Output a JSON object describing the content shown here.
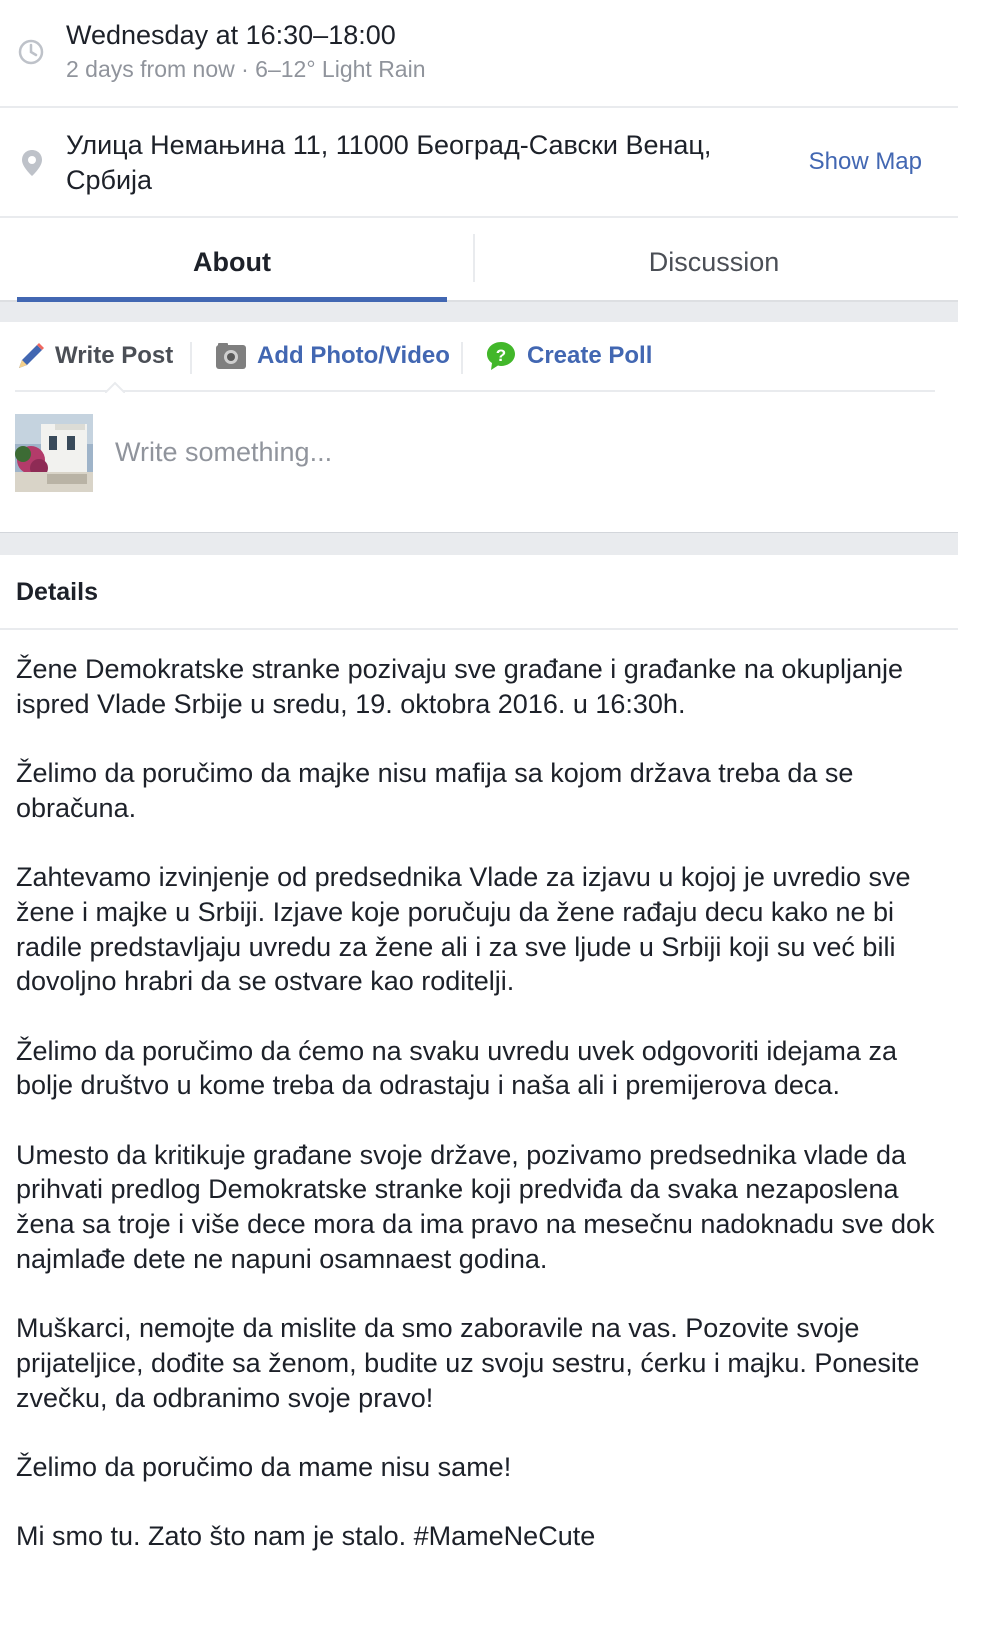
{
  "event": {
    "time_main": "Wednesday at 16:30–18:00",
    "time_sub": "2 days from now · 6–12° Light Rain",
    "location": "Улица Немањина 11, 11000 Београд-Савски Венац, Србија",
    "show_map_label": "Show Map"
  },
  "tabs": [
    {
      "label": "About",
      "active": true
    },
    {
      "label": "Discussion",
      "active": false
    }
  ],
  "composer": {
    "write_post_label": "Write Post",
    "add_photo_label": "Add Photo/Video",
    "create_poll_label": "Create Poll",
    "input_placeholder": "Write something..."
  },
  "details": {
    "title": "Details",
    "paragraphs": [
      "Žene Demokratske stranke pozivaju sve građane i građanke na okupljanje ispred Vlade Srbije u sredu, 19. oktobra 2016. u 16:30h.",
      "Želimo da poručimo da majke nisu mafija sa kojom država treba da se obračuna.",
      "Zahtevamo izvinjenje od predsednika Vlade za izjavu u kojoj je uvredio sve žene i majke u Srbiji. Izjave koje poručuju da žene rađaju decu kako ne bi radile predstavljaju uvredu za žene ali i za sve ljude u Srbiji koji su već bili dovoljno hrabri da se ostvare kao roditelji.",
      "Želimo da poručimo da ćemo na svaku uvredu uvek odgovoriti idejama za bolje društvo u kome treba da odrastaju i naša ali i premijerova deca.",
      "Umesto da kritikuje građane svoje države, pozivamo predsednika vlade da prihvati predlog Demokratske stranke koji predviđa da svaka nezaposlena žena sa troje i više dece mora da ima pravo na mesečnu nadoknadu sve dok najmlađe dete ne napuni osamnaest godina.",
      "Muškarci, nemojte da mislite da smo zaboravile na vas. Pozovite svoje prijateljice, dođite sa ženom, budite uz svoju sestru, ćerku i majku. Ponesite zvečku, da odbranimo svoje pravo!",
      "Želimo da poručimo da mame nisu same!",
      "Mi smo tu. Zato što nam je stalo. #MameNeCute"
    ]
  },
  "icons": {
    "time": "clock-icon",
    "location": "map-pin-icon",
    "write": "pencil-icon",
    "photo": "camera-icon",
    "poll": "poll-icon"
  },
  "colors": {
    "link": "#4267b2",
    "text": "#1d2129",
    "muted": "#90949c",
    "divider": "#e9ebee",
    "poll_green": "#42b72a"
  }
}
